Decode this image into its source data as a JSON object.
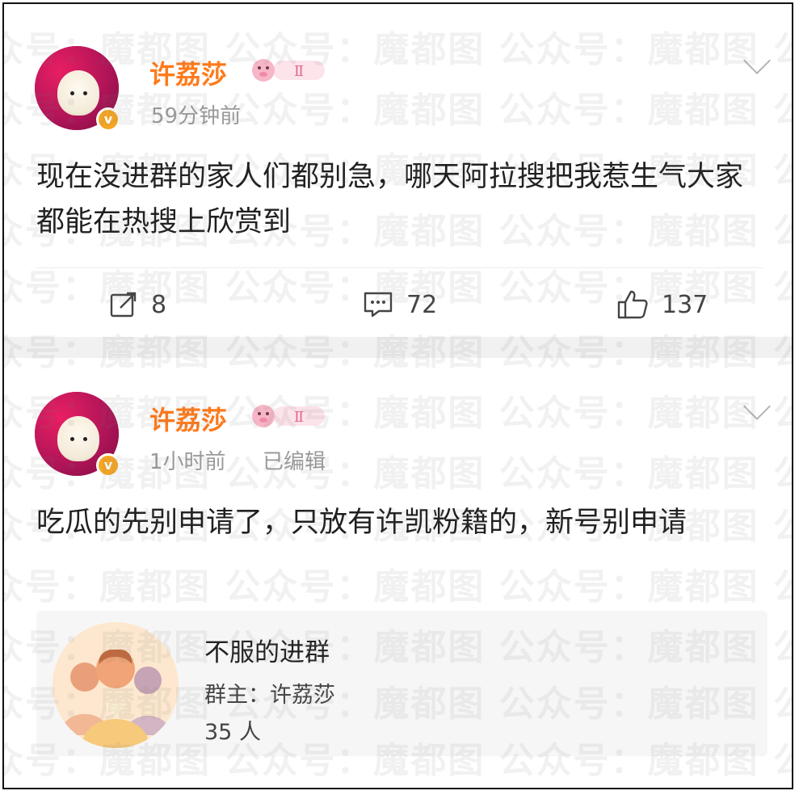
{
  "watermark": {
    "text": "众号：魔都图  公众号：魔都图  公众号：魔都图  公众号：魔都图"
  },
  "posts": [
    {
      "author": "许荔莎",
      "level_badge": "Ⅱ",
      "time": "59分钟前",
      "edited": "",
      "content": "现在没进群的家人们都别急，哪天阿拉搜把我惹生气大家都能在热搜上欣赏到",
      "reposts": "8",
      "comments": "72",
      "likes": "137"
    },
    {
      "author": "许荔莎",
      "level_badge": "Ⅱ",
      "time": "1小时前",
      "edited": "已编辑",
      "content": "吃瓜的先别申请了，只放有许凯粉籍的，新号别申请",
      "group": {
        "title": "不服的进群",
        "owner": "群主：许荔莎",
        "members": "35 人"
      }
    }
  ],
  "colors": {
    "name": "#ff7a1a",
    "badge": "#f5a623",
    "muted": "#9a9a9a"
  },
  "icons": {
    "repost": "repost-icon",
    "comment": "comment-icon",
    "like": "like-icon",
    "more": "chevron-down-icon",
    "verified": "verified-icon"
  }
}
